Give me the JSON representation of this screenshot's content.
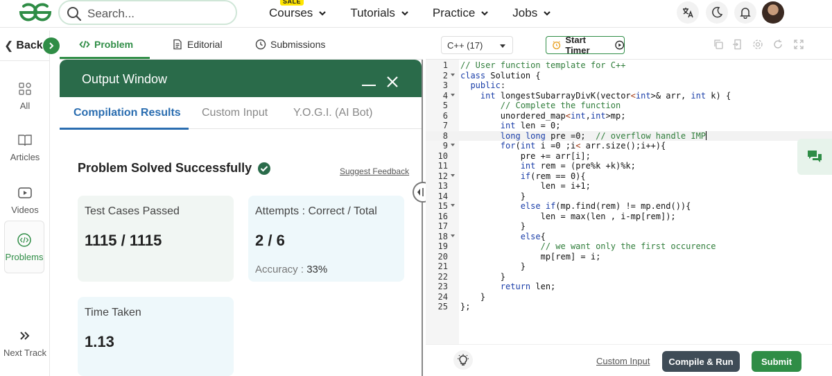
{
  "nav": {
    "search_placeholder": "Search...",
    "sale_badge": "SALE",
    "menu": [
      {
        "label": "Courses"
      },
      {
        "label": "Tutorials"
      },
      {
        "label": "Practice"
      },
      {
        "label": "Jobs"
      }
    ]
  },
  "rail": {
    "back_label": "Back",
    "items": [
      {
        "label": "All",
        "icon": "grid-icon"
      },
      {
        "label": "Articles",
        "icon": "book-icon"
      },
      {
        "label": "Videos",
        "icon": "video-icon"
      },
      {
        "label": "Problems",
        "icon": "code-icon",
        "active": true
      },
      {
        "label": "Next Track",
        "icon": "double-chevron-icon"
      }
    ]
  },
  "problem_tabs": [
    {
      "label": "Problem",
      "active": true
    },
    {
      "label": "Editorial"
    },
    {
      "label": "Submissions"
    }
  ],
  "output": {
    "title": "Output Window",
    "tabs": [
      {
        "label": "Compilation Results",
        "active": true
      },
      {
        "label": "Custom Input"
      },
      {
        "label": "Y.O.G.I. (AI Bot)"
      }
    ],
    "status": "Problem Solved Successfully",
    "feedback_link": "Suggest Feedback",
    "cards": {
      "tests_label": "Test Cases Passed",
      "tests_value": "1115 / 1115",
      "attempts_label": "Attempts : Correct / Total",
      "attempts_value": "2 / 6",
      "accuracy_label": "Accuracy :",
      "accuracy_value": "33%",
      "time_label": "Time Taken",
      "time_value": "1.13"
    }
  },
  "editor": {
    "language": "C++ (17)",
    "timer_label": "Start Timer",
    "custom_input_link": "Custom Input",
    "compile_label": "Compile & Run",
    "submit_label": "Submit",
    "lines": [
      "// User function template for C++",
      "class Solution {",
      "  public:",
      "    int longestSubarrayDivK(vector<int>& arr, int k) {",
      "        // Complete the function",
      "        unordered_map<int,int>mp;",
      "        int len = 0;",
      "        long long pre =0;  // overflow handle IMP",
      "        for(int i =0 ;i< arr.size();i++){",
      "            pre += arr[i];",
      "            int rem = (pre%k +k)%k;",
      "            if(rem == 0){",
      "                len = i+1;",
      "            }",
      "            else if(mp.find(rem) != mp.end()){",
      "                len = max(len , i-mp[rem]);",
      "            }",
      "            else{",
      "                // we want only the first occurence",
      "                mp[rem] = i;",
      "            }",
      "        }",
      "        return len;",
      "    }",
      "};"
    ]
  },
  "colors": {
    "brand_green": "#2f8d46",
    "output_header": "#2a6b4a",
    "active_tab_blue": "#2a6db0"
  }
}
